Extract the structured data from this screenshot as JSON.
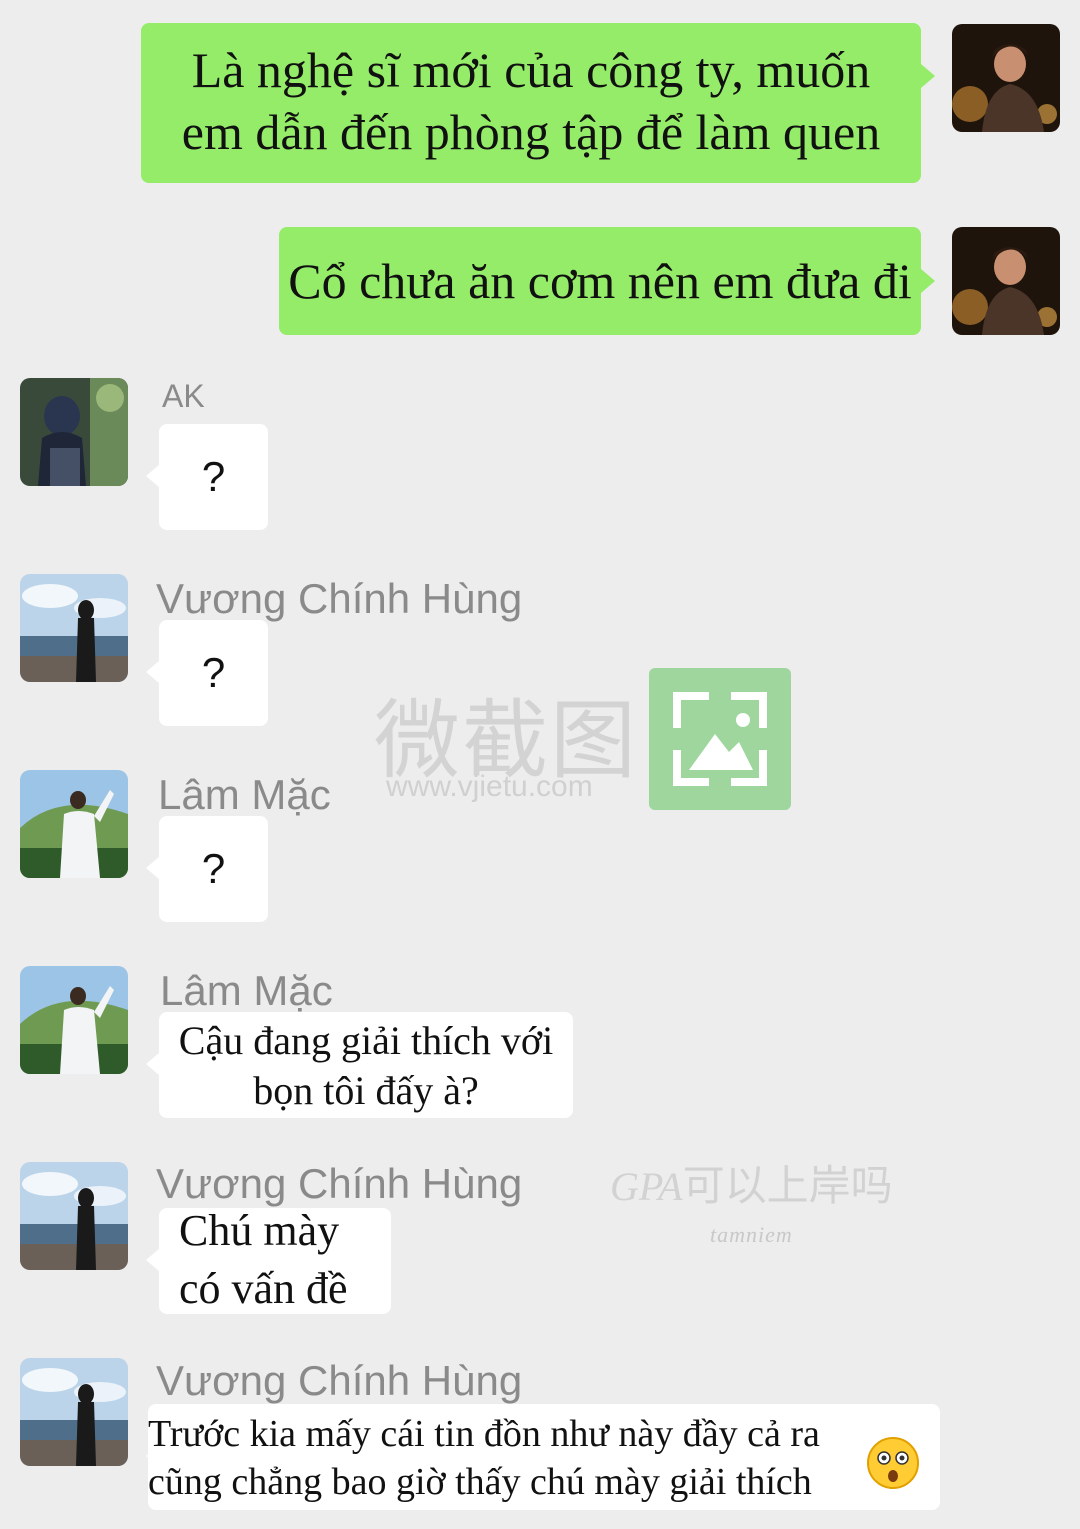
{
  "outgoing": [
    {
      "text": "Là nghệ sĩ mới của công ty, muốn\nem dẫn đến phòng tập để làm quen"
    },
    {
      "text": "Cổ chưa ăn cơm nên em đưa đi"
    }
  ],
  "incoming": [
    {
      "sender": "AK",
      "text": "?"
    },
    {
      "sender": "Vương Chính Hùng",
      "text": "?"
    },
    {
      "sender": "Lâm Mặc",
      "text": "?"
    },
    {
      "sender": "Lâm Mặc",
      "text": "Cậu đang giải thích với\nbọn tôi đấy à?"
    },
    {
      "sender": "Vương Chính Hùng",
      "text": "Chú mày\ncó vấn đề"
    },
    {
      "sender": "Vương Chính Hùng",
      "text": "Trước kia mấy cái tin đồn như này đầy cả ra\ncũng chẳng bao giờ thấy chú mày giải thích"
    }
  ],
  "watermarks": {
    "app_name": "微截图",
    "app_url": "www.vjietu.com",
    "credit_left": "GPA",
    "credit_right": "可以上岸吗",
    "credit_sub": "tamniem"
  },
  "emoji": "surprised-face-icon",
  "colors": {
    "outgoing_bubble": "#95ec69",
    "incoming_bubble": "#ffffff",
    "background": "#ededed"
  }
}
